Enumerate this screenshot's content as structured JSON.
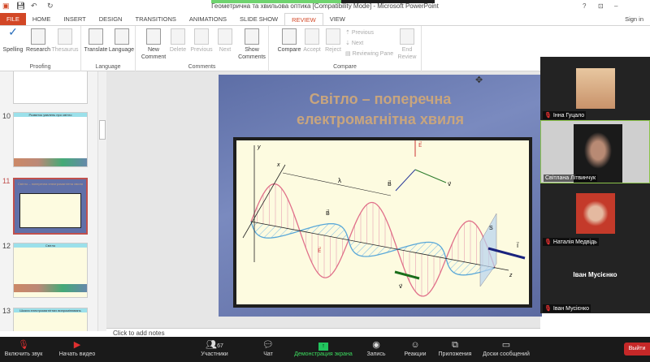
{
  "window": {
    "title": "Геометрична та хвильова оптика [Compatibility Mode] - Microsoft PowerPoint",
    "sign_in": "Sign in",
    "help": "?"
  },
  "tabs": [
    "FILE",
    "HOME",
    "INSERT",
    "DESIGN",
    "TRANSITIONS",
    "ANIMATIONS",
    "SLIDE SHOW",
    "REVIEW",
    "VIEW"
  ],
  "active_tab": "REVIEW",
  "ribbon": {
    "proofing": {
      "label": "Proofing",
      "buttons": [
        "Spelling",
        "Research",
        "Thesaurus"
      ]
    },
    "language": {
      "label": "Language",
      "buttons": [
        "Translate",
        "Language"
      ]
    },
    "comments": {
      "label": "Comments",
      "buttons": [
        "New Comment",
        "Delete",
        "Previous",
        "Next",
        "Show Comments"
      ]
    },
    "compare": {
      "label": "Compare",
      "buttons": [
        "Compare",
        "Accept",
        "Reject",
        "Previous",
        "Next",
        "Reviewing Pane",
        "End Review"
      ]
    }
  },
  "thumbnails": [
    {
      "num": "10",
      "title": "Розвиток уявлень про світло"
    },
    {
      "num": "11",
      "title": "Світло – поперечна електромагнітна хвиля"
    },
    {
      "num": "12",
      "title": "Світло"
    },
    {
      "num": "13",
      "title": "Шкала електромагнітних випромінювань"
    }
  ],
  "slide": {
    "title_line1": "Світло – поперечна",
    "title_line2": "електромагнітна хвиля",
    "labels": {
      "y": "y",
      "x": "x",
      "z": "z",
      "lambda": "λ",
      "E": "E⃗",
      "B": "B⃗",
      "v": "v⃗",
      "I": "I⃗",
      "S": "S"
    }
  },
  "notes_placeholder": "Click to add notes",
  "participants": [
    {
      "name": "Інна Гуцало",
      "muted": true
    },
    {
      "name": "Світлана Літвинчук",
      "muted": false
    },
    {
      "name": "Наталія Медвідь",
      "muted": true
    },
    {
      "name": "Іван Мусієнко",
      "muted": true,
      "display": "Іван Мусієнко"
    }
  ],
  "zoom_toolbar": {
    "mute": "Включить звук",
    "video": "Начать видео",
    "participants": "Участники",
    "participants_count": "67",
    "chat": "Чат",
    "share": "Демонстрация экрана",
    "record": "Запись",
    "reactions": "Реакции",
    "apps": "Приложения",
    "whiteboards": "Доски сообщений",
    "leave": "Выйти"
  },
  "colors": {
    "file_tab": "#d24726",
    "share_green": "#22c55e",
    "leave": "#c62828",
    "e_wave": "#e0708a",
    "b_wave": "#5aa8d8"
  }
}
